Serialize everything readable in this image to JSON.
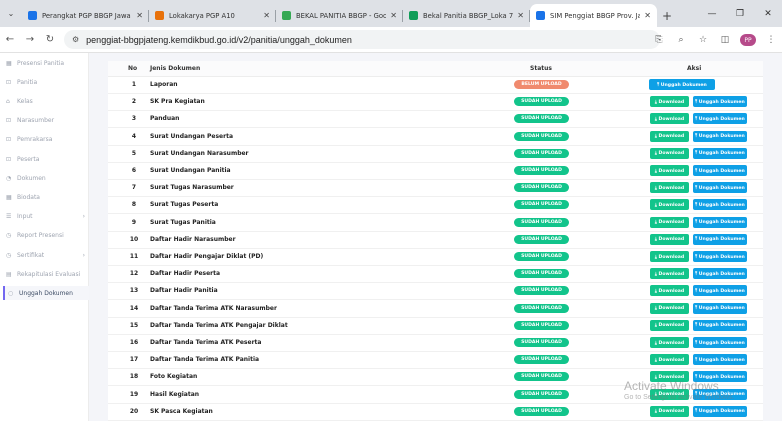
{
  "browser": {
    "tabs": [
      {
        "title": "Perangkat PGP BBGP Jawa Te",
        "color": "#1a73e8",
        "active": false
      },
      {
        "title": "Lokakarya PGP A10",
        "color": "#e8710a",
        "active": false
      },
      {
        "title": "BEKAL PANITIA BBGP - Goo",
        "color": "#34a853",
        "active": false
      },
      {
        "title": "Bekal Panitia BBGP_Loka 7_",
        "color": "#0f9d58",
        "active": false
      },
      {
        "title": "SIM Penggiat BBGP Prov. Ja",
        "color": "#1a73e8",
        "active": true
      }
    ],
    "new_tab": "+",
    "url": "penggiat-bbgpjateng.kemdikbud.go.id/v2/panitia/unggah_dokumen",
    "profile": "PP"
  },
  "sidebar": {
    "items": [
      {
        "label": "Presensi Panitia",
        "icon": "▦",
        "arrow": ""
      },
      {
        "label": "Panitia",
        "icon": "⊡",
        "arrow": ""
      },
      {
        "label": "Kelas",
        "icon": "⌂",
        "arrow": ""
      },
      {
        "label": "Narasumber",
        "icon": "⊡",
        "arrow": ""
      },
      {
        "label": "Pemrakarsa",
        "icon": "⊡",
        "arrow": ""
      },
      {
        "label": "Peserta",
        "icon": "⊡",
        "arrow": ""
      },
      {
        "label": "Dokumen",
        "icon": "◔",
        "arrow": ""
      },
      {
        "label": "Biodata",
        "icon": "▦",
        "arrow": ""
      },
      {
        "label": "Input",
        "icon": "☰",
        "arrow": "›"
      },
      {
        "label": "Report Presensi",
        "icon": "◷",
        "arrow": ""
      },
      {
        "label": "Sertifikat",
        "icon": "◷",
        "arrow": "›"
      },
      {
        "label": "Rekapitulasi Evaluasi",
        "icon": "▤",
        "arrow": ""
      },
      {
        "label": "Unggah Dokumen",
        "icon": "○",
        "arrow": "",
        "active": true
      }
    ]
  },
  "table": {
    "headers": {
      "no": "No",
      "jenis": "Jenis Dokumen",
      "status": "Status",
      "aksi": "Aksi"
    },
    "download_label": "⤓ Download",
    "upload_label": "⤒ Unggah Dokumen",
    "status_colors": {
      "belum": "#f08a6e",
      "sudah": "#12c48b"
    },
    "rows": [
      {
        "no": "1",
        "jenis": "Laporan",
        "status": "BELUM UPLOAD",
        "uploaded": false
      },
      {
        "no": "2",
        "jenis": "SK Pra Kegiatan",
        "status": "SUDAH UPLOAD",
        "uploaded": true
      },
      {
        "no": "3",
        "jenis": "Panduan",
        "status": "SUDAH UPLOAD",
        "uploaded": true
      },
      {
        "no": "4",
        "jenis": "Surat Undangan Peserta",
        "status": "SUDAH UPLOAD",
        "uploaded": true
      },
      {
        "no": "5",
        "jenis": "Surat Undangan Narasumber",
        "status": "SUDAH UPLOAD",
        "uploaded": true
      },
      {
        "no": "6",
        "jenis": "Surat Undangan Panitia",
        "status": "SUDAH UPLOAD",
        "uploaded": true
      },
      {
        "no": "7",
        "jenis": "Surat Tugas Narasumber",
        "status": "SUDAH UPLOAD",
        "uploaded": true
      },
      {
        "no": "8",
        "jenis": "Surat Tugas Peserta",
        "status": "SUDAH UPLOAD",
        "uploaded": true
      },
      {
        "no": "9",
        "jenis": "Surat Tugas Panitia",
        "status": "SUDAH UPLOAD",
        "uploaded": true
      },
      {
        "no": "10",
        "jenis": "Daftar Hadir Narasumber",
        "status": "SUDAH UPLOAD",
        "uploaded": true
      },
      {
        "no": "11",
        "jenis": "Daftar Hadir Pengajar Diklat (PD)",
        "status": "SUDAH UPLOAD",
        "uploaded": true
      },
      {
        "no": "12",
        "jenis": "Daftar Hadir Peserta",
        "status": "SUDAH UPLOAD",
        "uploaded": true
      },
      {
        "no": "13",
        "jenis": "Daftar Hadir Panitia",
        "status": "SUDAH UPLOAD",
        "uploaded": true
      },
      {
        "no": "14",
        "jenis": "Daftar Tanda Terima ATK Narasumber",
        "status": "SUDAH UPLOAD",
        "uploaded": true
      },
      {
        "no": "15",
        "jenis": "Daftar Tanda Terima ATK Pengajar Diklat",
        "status": "SUDAH UPLOAD",
        "uploaded": true
      },
      {
        "no": "16",
        "jenis": "Daftar Tanda Terima ATK Peserta",
        "status": "SUDAH UPLOAD",
        "uploaded": true
      },
      {
        "no": "17",
        "jenis": "Daftar Tanda Terima ATK Panitia",
        "status": "SUDAH UPLOAD",
        "uploaded": true
      },
      {
        "no": "18",
        "jenis": "Foto Kegiatan",
        "status": "SUDAH UPLOAD",
        "uploaded": true
      },
      {
        "no": "19",
        "jenis": "Hasil Kegiatan",
        "status": "SUDAH UPLOAD",
        "uploaded": true
      },
      {
        "no": "20",
        "jenis": "SK Pasca Kegiatan",
        "status": "SUDAH UPLOAD",
        "uploaded": true
      }
    ]
  },
  "watermark": {
    "line1": "Activate Windows",
    "line2": "Go to Settings to activate Windows."
  }
}
